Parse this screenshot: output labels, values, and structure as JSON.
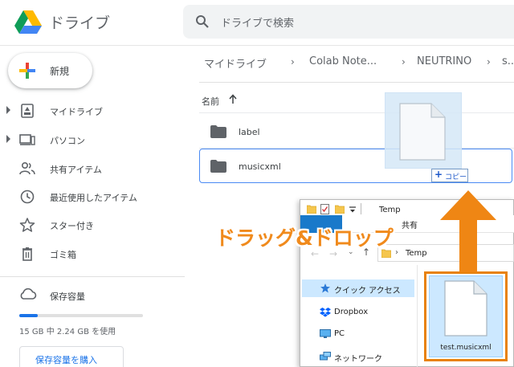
{
  "app": {
    "title": "ドライブ"
  },
  "search": {
    "placeholder": "ドライブで検索"
  },
  "sidebar": {
    "new_label": "新規",
    "items": [
      {
        "label": "マイドライブ",
        "icon": "my-drive-icon",
        "expandable": true
      },
      {
        "label": "パソコン",
        "icon": "computer-icon",
        "expandable": true
      },
      {
        "label": "共有アイテム",
        "icon": "shared-people-icon",
        "expandable": false
      },
      {
        "label": "最近使用したアイテム",
        "icon": "clock-icon",
        "expandable": false
      },
      {
        "label": "スター付き",
        "icon": "star-icon",
        "expandable": false
      },
      {
        "label": "ゴミ箱",
        "icon": "trash-icon",
        "expandable": false
      }
    ],
    "storage": {
      "label": "保存容量",
      "usage_text": "15 GB 中 2.24 GB を使用",
      "used_fraction": 0.15,
      "buy_label": "保存容量を購入"
    }
  },
  "breadcrumb": [
    "マイドライブ",
    "Colab Note...",
    "NEUTRINO",
    "s..."
  ],
  "file_list": {
    "column_name": "名前",
    "rows": [
      {
        "name": "label",
        "type": "folder",
        "selected": false
      },
      {
        "name": "musicxml",
        "type": "folder",
        "selected": true
      }
    ]
  },
  "drag": {
    "copy_label": "コピー"
  },
  "explorer": {
    "title": "Temp",
    "ribbon_tab": "共有",
    "address": "Temp",
    "nav_pane": [
      {
        "label": "クイック アクセス",
        "icon": "quick-access-star-icon",
        "selected": true
      },
      {
        "label": "Dropbox",
        "icon": "dropbox-icon",
        "selected": false
      },
      {
        "label": "PC",
        "icon": "pc-monitor-icon",
        "selected": false
      },
      {
        "label": "ネットワーク",
        "icon": "network-icon",
        "selected": false
      }
    ],
    "file": {
      "name": "test.musicxml"
    }
  },
  "annotation": {
    "text": "ドラッグ&ドロップ",
    "color": "#f08a1c"
  },
  "colors": {
    "accent_blue": "#1a73e8",
    "selection_border": "#4a8af4",
    "annotation_orange": "#e8820c"
  }
}
